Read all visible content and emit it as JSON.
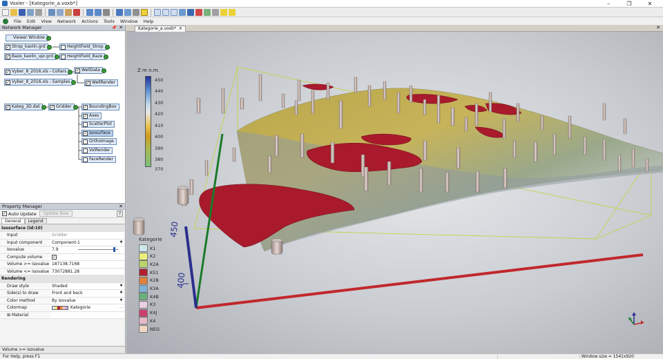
{
  "window": {
    "title": "Voxler - [Kategorie_a.voxb*]",
    "min": "–",
    "max": "❐",
    "close": "✕"
  },
  "menu": [
    "File",
    "Edit",
    "View",
    "Network",
    "Actions",
    "Tools",
    "Window",
    "Help"
  ],
  "network_manager": {
    "title": "Network Manager",
    "nodes": [
      {
        "label": "Viewer Window"
      },
      {
        "label": "Strop_kaolin.grd"
      },
      {
        "label": "HeightField_Strop"
      },
      {
        "label": "Baze_kaolin_upr.grd"
      },
      {
        "label": "HeightField_Baze"
      },
      {
        "label": "Vyber_8_2016.xls - Collars"
      },
      {
        "label": "WellData"
      },
      {
        "label": "Vyber_8_2016.xls - Samples"
      },
      {
        "label": "WellRender"
      },
      {
        "label": "Kateg_3D.dat"
      },
      {
        "label": "Gridder"
      },
      {
        "label": "BoundingBox"
      },
      {
        "label": "Axes"
      },
      {
        "label": "ScatterPlot"
      },
      {
        "label": "Isosurface"
      },
      {
        "label": "OrthoImage"
      },
      {
        "label": "VolRender"
      },
      {
        "label": "FaceRender"
      }
    ]
  },
  "property_manager": {
    "title": "Property Manager",
    "auto_update": "Auto Update",
    "update_now": "Update Now",
    "help": "?",
    "tabs": [
      "General",
      "Legend"
    ],
    "section1": "Isosurface (id:10)",
    "rows1": [
      {
        "k": "Input",
        "v": "Gridder"
      },
      {
        "k": "Input component",
        "v": "Component-1"
      },
      {
        "k": "Isovalue",
        "v": "7.9"
      },
      {
        "k": "Compute volume",
        "v": "✓"
      },
      {
        "k": "Volume >= isovalue",
        "v": "187138.7168"
      },
      {
        "k": "Volume <= isovalue",
        "v": "73072881.28"
      }
    ],
    "section2": "Rendering",
    "rows2": [
      {
        "k": "Draw style",
        "v": "Shaded"
      },
      {
        "k": "Side(s) to draw",
        "v": "Front and back"
      },
      {
        "k": "Color method",
        "v": "By isovalue"
      },
      {
        "k": "Colormap",
        "v": "Kategorie"
      },
      {
        "k": "Material",
        "v": ""
      }
    ],
    "footer": "Volume >= isovalue",
    "isovalue_fraction": 0.9
  },
  "document": {
    "tab": "Kategorie_a.voxb*"
  },
  "legend_z": {
    "title": "Z m n.m.",
    "ticks": [
      "450",
      "440",
      "430",
      "420",
      "410",
      "400",
      "390",
      "380",
      "370"
    ]
  },
  "legend_k": {
    "title": "Kategorie",
    "items": [
      {
        "label": "K1",
        "color": "#cde6ea"
      },
      {
        "label": "K2",
        "color": "#eaf07c"
      },
      {
        "label": "K2A",
        "color": "#b9d46a"
      },
      {
        "label": "KS1",
        "color": "#b0202e"
      },
      {
        "label": "K2B",
        "color": "#e0803a"
      },
      {
        "label": "K3A",
        "color": "#7fb2d8"
      },
      {
        "label": "K4B",
        "color": "#6ab07a"
      },
      {
        "label": "K3",
        "color": "#e8d0e0"
      },
      {
        "label": "K4J",
        "color": "#cc3f6e"
      },
      {
        "label": "K4",
        "color": "#e6b8c8"
      },
      {
        "label": "NEG",
        "color": "#f0d8c4"
      }
    ]
  },
  "axis_labels": {
    "z450": "450",
    "z400": "400"
  },
  "status": {
    "left": "For Help, press F1",
    "right": "Window size = 1541x920"
  }
}
